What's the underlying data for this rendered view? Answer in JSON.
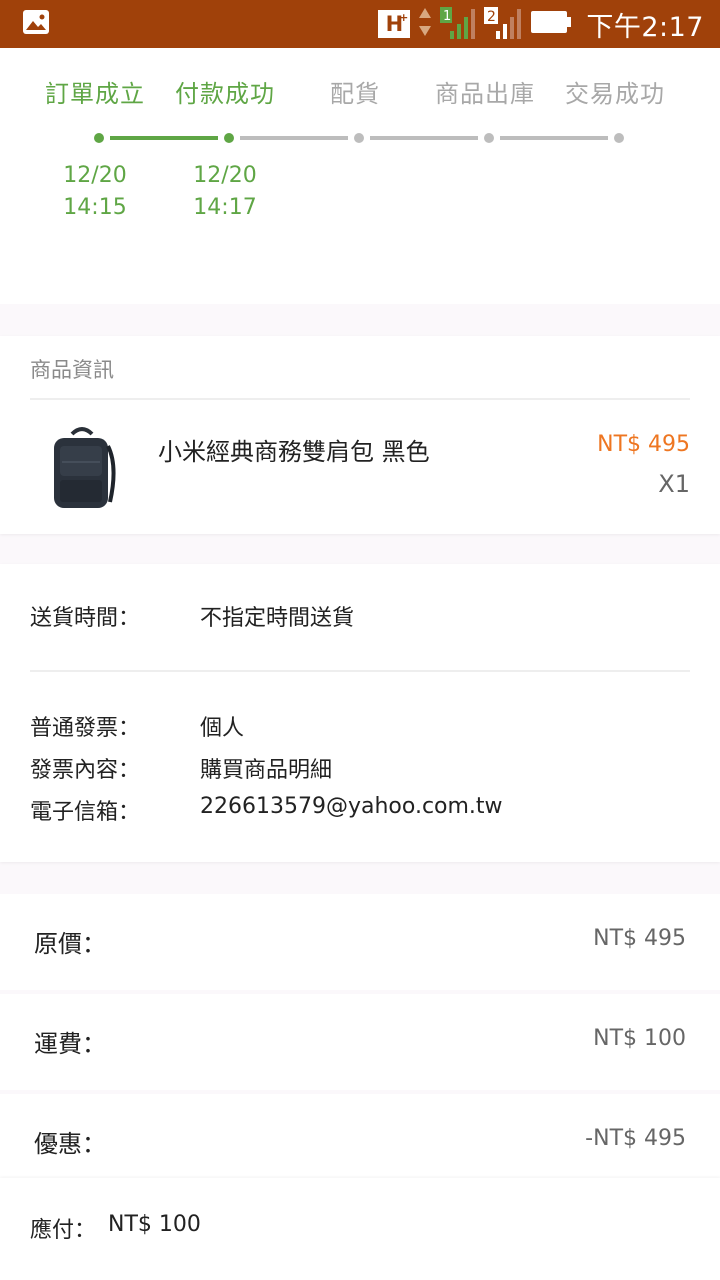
{
  "status_bar": {
    "network": "H",
    "network_sup": "+",
    "sim2": "2",
    "time": "下午2:17",
    "icons": [
      "image-icon",
      "signal-arrows-icon",
      "signal-bars-icon",
      "sim2-signal-icon",
      "battery-icon"
    ]
  },
  "progress": {
    "steps": [
      {
        "label": "訂單成立",
        "done": true,
        "date": "12/20",
        "time": "14:15"
      },
      {
        "label": "付款成功",
        "done": true,
        "date": "12/20",
        "time": "14:17"
      },
      {
        "label": "配貨",
        "done": false
      },
      {
        "label": "商品出庫",
        "done": false
      },
      {
        "label": "交易成功",
        "done": false
      }
    ]
  },
  "product": {
    "section_title": "商品資訊",
    "name": "小米經典商務雙肩包 黑色",
    "price": "NT$ 495",
    "quantity": "X1"
  },
  "delivery": {
    "label": "送貨時間：",
    "value": "不指定時間送貨"
  },
  "invoice": {
    "type_label": "普通發票：",
    "type_value": "個人",
    "content_label": "發票內容：",
    "content_value": "購買商品明細",
    "email_label": "電子信箱：",
    "email_value": "226613579@yahoo.com.tw"
  },
  "pricing": {
    "original_label": "原價：",
    "original_value": "NT$ 495",
    "shipping_label": "運費：",
    "shipping_value": "NT$ 100",
    "discount_label": "優惠：",
    "discount_value": "-NT$ 495",
    "payable_label": "應付：",
    "payable_value": "NT$ 100"
  },
  "colors": {
    "status_bar": "#a0410a",
    "accent_green": "#5fa645",
    "inactive_grey": "#a8a8a8",
    "price_orange": "#ee7621"
  }
}
